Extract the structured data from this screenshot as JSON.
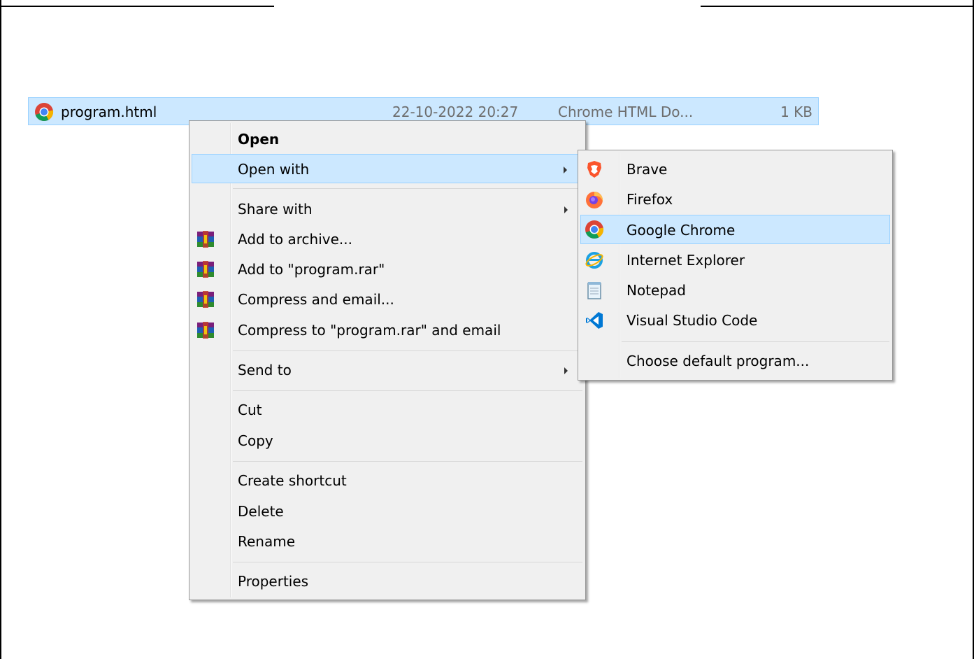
{
  "file": {
    "name": "program.html",
    "date": "22-10-2022 20:27",
    "type": "Chrome HTML Do...",
    "size": "1 KB"
  },
  "context_menu": {
    "open": "Open",
    "open_with": "Open with",
    "share_with": "Share with",
    "add_to_archive": "Add to archive...",
    "add_to_rar": "Add to \"program.rar\"",
    "compress_email": "Compress and email...",
    "compress_rar_email": "Compress to \"program.rar\" and email",
    "send_to": "Send to",
    "cut": "Cut",
    "copy": "Copy",
    "create_shortcut": "Create shortcut",
    "delete": "Delete",
    "rename": "Rename",
    "properties": "Properties"
  },
  "open_with_menu": {
    "brave": "Brave",
    "firefox": "Firefox",
    "chrome": "Google Chrome",
    "ie": "Internet Explorer",
    "notepad": "Notepad",
    "vscode": "Visual Studio Code",
    "choose_default": "Choose default program..."
  },
  "colors": {
    "highlight": "#cce8ff",
    "highlight_border": "#99d1ff",
    "menu_bg": "#f0f0f0"
  }
}
